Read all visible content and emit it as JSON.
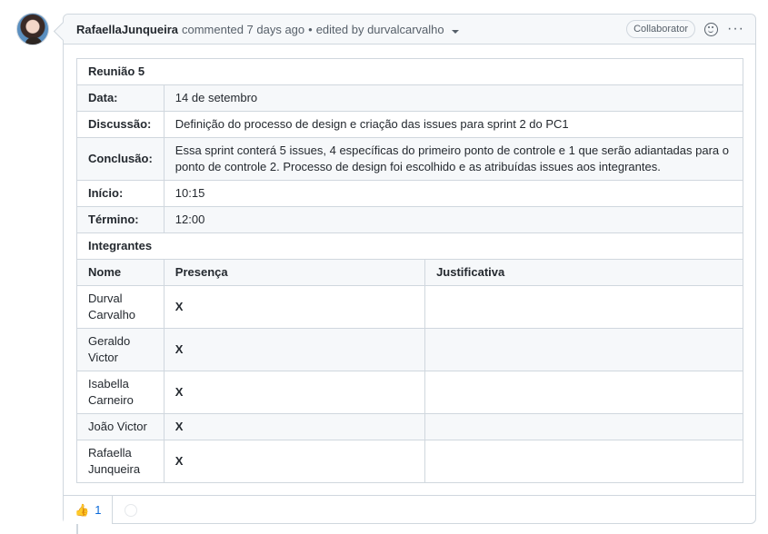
{
  "comment": {
    "author": "RafaellaJunqueira",
    "action": "commented 7 days ago",
    "separator": "•",
    "edited_by": "edited by durvalcarvalho",
    "role_badge": "Collaborator",
    "icons": {
      "avatar": "user-avatar",
      "reaction_picker": "smiley-icon",
      "menu": "kebab-icon",
      "edit_caret": "caret-down-icon"
    }
  },
  "meeting": {
    "title": "Reunião 5",
    "fields": [
      {
        "label": "Data:",
        "value": "14 de setembro"
      },
      {
        "label": "Discussão:",
        "value": "Definição do processo de design e criação das issues para sprint 2 do PC1"
      },
      {
        "label": "Conclusão:",
        "value": "Essa sprint conterá 5 issues, 4 específicas do primeiro ponto de controle e 1 que serão adiantadas para o ponto de controle 2. Processo de design foi escolhido e as atribuídas issues aos integrantes."
      },
      {
        "label": "Início:",
        "value": "10:15"
      },
      {
        "label": "Término:",
        "value": "12:00"
      }
    ],
    "members_heading": "Integrantes",
    "columns": [
      "Nome",
      "Presença",
      "Justificativa"
    ],
    "members": [
      {
        "name": "Durval Carvalho",
        "presence": "X",
        "justification": ""
      },
      {
        "name": "Geraldo Victor",
        "presence": "X",
        "justification": ""
      },
      {
        "name": "Isabella Carneiro",
        "presence": "X",
        "justification": ""
      },
      {
        "name": "João Victor",
        "presence": "X",
        "justification": ""
      },
      {
        "name": "Rafaella Junqueira",
        "presence": "X",
        "justification": ""
      }
    ]
  },
  "reactions": {
    "thumbs_up_glyph": "👍",
    "thumbs_up_count": "1"
  }
}
